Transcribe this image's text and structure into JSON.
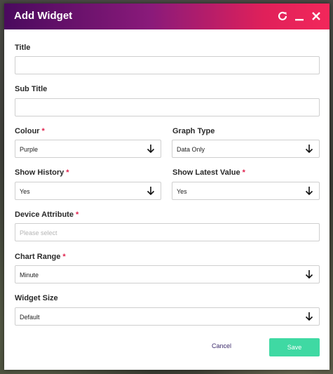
{
  "dialog": {
    "title": "Add Widget",
    "refresh_icon": "refresh-icon",
    "minimize_icon": "minimize-icon",
    "close_icon": "close-icon"
  },
  "form": {
    "title": {
      "label": "Title",
      "value": ""
    },
    "subtitle": {
      "label": "Sub Title",
      "value": ""
    },
    "colour": {
      "label": "Colour",
      "required_mark": "*",
      "value": "Purple"
    },
    "graph_type": {
      "label": "Graph Type",
      "value": "Data Only"
    },
    "show_history": {
      "label": "Show History",
      "required_mark": "*",
      "value": "Yes"
    },
    "show_latest": {
      "label": "Show Latest Value",
      "required_mark": "*",
      "value": "Yes"
    },
    "device_attribute": {
      "label": "Device Attribute",
      "required_mark": "*",
      "placeholder": "Please select"
    },
    "chart_range": {
      "label": "Chart Range",
      "required_mark": "*",
      "value": "Minute"
    },
    "widget_size": {
      "label": "Widget Size",
      "value": "Default"
    }
  },
  "footer": {
    "cancel_label": "Cancel",
    "save_label": "Save"
  },
  "colors": {
    "header_start": "#4a0a5e",
    "header_end": "#f2275a",
    "required": "#e0234e",
    "save": "#3fd9a3"
  }
}
